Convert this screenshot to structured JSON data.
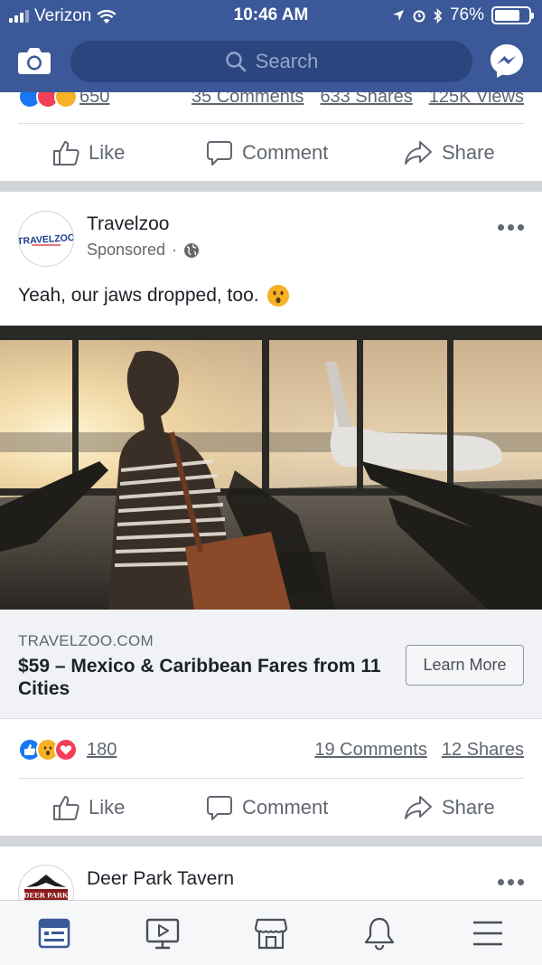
{
  "status_bar": {
    "carrier": "Verizon",
    "time": "10:46 AM",
    "battery": "76%",
    "battery_level": 0.76
  },
  "header": {
    "search_placeholder": "Search"
  },
  "previous_post": {
    "reaction_count": "650",
    "comments": "35 Comments",
    "shares": "633 Shares",
    "views": "125K Views"
  },
  "actions": {
    "like": "Like",
    "comment": "Comment",
    "share": "Share"
  },
  "post": {
    "author": "Travelzoo",
    "logo_text": "TRAVELZOO",
    "sponsored": "Sponsored",
    "meta_dot": "·",
    "text": "Yeah, our jaws dropped, too.",
    "link": {
      "domain": "TRAVELZOO.COM",
      "title": "$59 – Mexico & Caribbean Fares from 11 Cities",
      "button": "Learn More"
    },
    "reaction_count": "180",
    "comments": "19 Comments",
    "shares": "12 Shares"
  },
  "next_post": {
    "author": "Deer Park Tavern",
    "logo_text": "DEER PARK"
  },
  "colors": {
    "brand": "#3b5998",
    "like_blue": "#1877f2",
    "love_red": "#f33e58",
    "wow_yellow": "#f7b125"
  },
  "tab_bar": {
    "icons": [
      "news-feed-icon",
      "watch-icon",
      "marketplace-icon",
      "notifications-icon",
      "menu-icon"
    ]
  }
}
